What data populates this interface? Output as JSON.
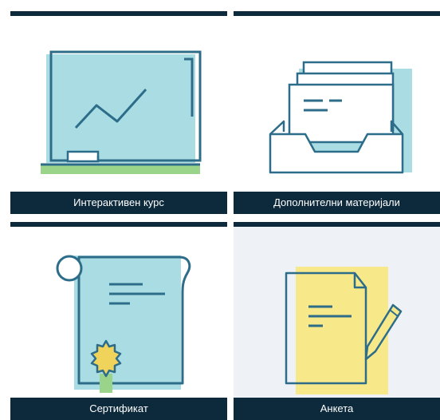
{
  "tiles": [
    {
      "label": "Интерактивен курс",
      "icon": "chalkboard-icon"
    },
    {
      "label": "Дополнителни материјали",
      "icon": "document-tray-icon"
    },
    {
      "label": "Сертификат",
      "icon": "certificate-scroll-icon"
    },
    {
      "label": "Анкета",
      "icon": "survey-pencil-icon"
    }
  ],
  "colors": {
    "header_bar": "#0d2a3d",
    "accent_blue": "#a9dde3",
    "stroke": "#2d6d8a",
    "green": "#9ad48a",
    "yellow": "#f7e889",
    "gold": "#f0d35a"
  }
}
